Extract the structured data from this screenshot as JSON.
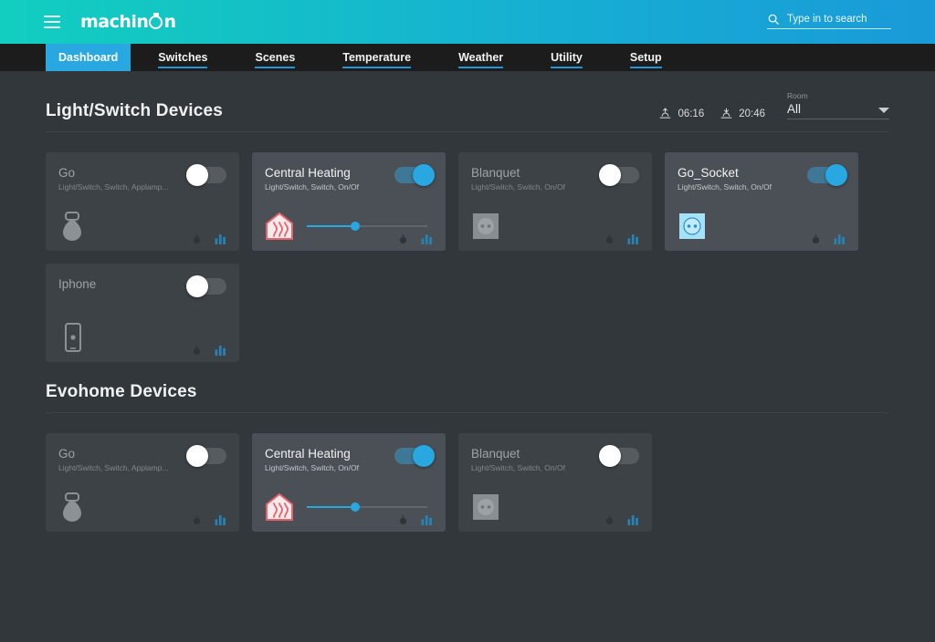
{
  "header": {
    "menu_icon": "hamburger-icon",
    "logo_text_before": "machin",
    "logo_text_after": "n",
    "logo_icon": "logo-o-icon",
    "search": {
      "icon": "search-icon",
      "placeholder": "Type in to search",
      "value": ""
    }
  },
  "nav": {
    "items": [
      {
        "label": "Dashboard",
        "active": true
      },
      {
        "label": "Switches",
        "active": false
      },
      {
        "label": "Scenes",
        "active": false
      },
      {
        "label": "Temperature",
        "active": false
      },
      {
        "label": "Weather",
        "active": false
      },
      {
        "label": "Utility",
        "active": false
      },
      {
        "label": "Setup",
        "active": false
      }
    ]
  },
  "colors": {
    "accent_blue": "#29a7e1",
    "accent_teal": "#12cec0",
    "page_bg": "#31373b",
    "card_bg": "#3c4246",
    "card_bg_on": "#4a5055",
    "nav_bg": "#1c1c1c",
    "heating_red": "#e8616b"
  },
  "sections": [
    {
      "title": "Light/Switch Devices",
      "sunrise": {
        "icon": "sunrise-icon",
        "time": "06:16"
      },
      "sunset": {
        "icon": "sunset-icon",
        "time": "20:46"
      },
      "room_filter": {
        "label": "Room",
        "value": "All",
        "caret": "chevron-down-icon"
      },
      "cards": [
        {
          "title": "Go",
          "subtitle": "Light/Switch, Switch, Applamp...",
          "state": "off",
          "device_icon": "lamp-icon",
          "has_slider": false,
          "timer_icon": "timer-icon",
          "chart_icon": "bar-chart-icon"
        },
        {
          "title": "Central Heating",
          "subtitle": "Light/Switch, Switch, On/Of",
          "state": "on",
          "device_icon": "heater-icon",
          "has_slider": true,
          "slider_value": 40,
          "timer_icon": "timer-icon",
          "chart_icon": "bar-chart-icon"
        },
        {
          "title": "Blanquet",
          "subtitle": "Light/Switch, Switch, On/Of",
          "state": "off",
          "device_icon": "socket-icon",
          "has_slider": false,
          "timer_icon": "timer-icon",
          "chart_icon": "bar-chart-icon"
        },
        {
          "title": "Go_Socket",
          "subtitle": "Light/Switch, Switch, On/Of",
          "state": "on",
          "device_icon": "socket-icon",
          "has_slider": false,
          "timer_icon": "timer-icon",
          "chart_icon": "bar-chart-icon"
        },
        {
          "title": "Iphone",
          "subtitle": "",
          "state": "off",
          "device_icon": "phone-icon",
          "has_slider": false,
          "timer_icon": "timer-icon",
          "chart_icon": "bar-chart-icon"
        }
      ]
    },
    {
      "title": "Evohome Devices",
      "cards": [
        {
          "title": "Go",
          "subtitle": "Light/Switch, Switch, Applamp...",
          "state": "off",
          "device_icon": "lamp-icon",
          "has_slider": false,
          "timer_icon": "timer-icon",
          "chart_icon": "bar-chart-icon"
        },
        {
          "title": "Central Heating",
          "subtitle": "Light/Switch, Switch, On/Of",
          "state": "on",
          "device_icon": "heater-icon",
          "has_slider": true,
          "slider_value": 40,
          "timer_icon": "timer-icon",
          "chart_icon": "bar-chart-icon"
        },
        {
          "title": "Blanquet",
          "subtitle": "Light/Switch, Switch, On/Of",
          "state": "off",
          "device_icon": "socket-icon",
          "has_slider": false,
          "timer_icon": "timer-icon",
          "chart_icon": "bar-chart-icon"
        }
      ]
    }
  ]
}
